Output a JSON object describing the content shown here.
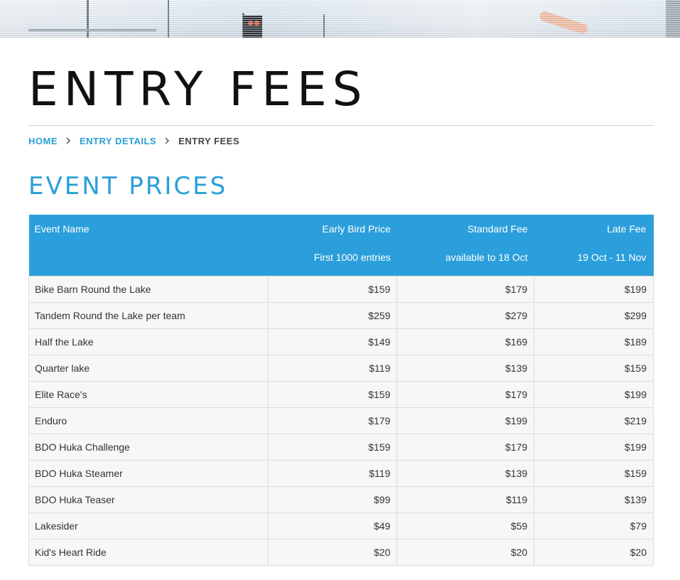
{
  "page": {
    "title": "ENTRY FEES",
    "section_title": "EVENT PRICES"
  },
  "breadcrumb": {
    "items": [
      {
        "label": "HOME"
      },
      {
        "label": "ENTRY DETAILS"
      },
      {
        "label": "ENTRY FEES"
      }
    ]
  },
  "colors": {
    "accent": "#2b9fdb",
    "title": "#111111",
    "row_bg": "#f7f7f7",
    "border": "#dcdcdc"
  },
  "table": {
    "headers": [
      {
        "line1": "Event Name",
        "line2": ""
      },
      {
        "line1": "Early Bird Price",
        "line2": "First 1000 entries"
      },
      {
        "line1": "Standard Fee",
        "line2": "available to 18 Oct"
      },
      {
        "line1": "Late Fee",
        "line2": "19 Oct - 11 Nov"
      }
    ],
    "rows": [
      [
        "Bike Barn Round the Lake",
        "$159",
        "$179",
        "$199"
      ],
      [
        "Tandem Round the Lake per team",
        "$259",
        "$279",
        "$299"
      ],
      [
        "Half the Lake",
        "$149",
        "$169",
        "$189"
      ],
      [
        "Quarter lake",
        "$119",
        "$139",
        "$159"
      ],
      [
        "Elite Race's",
        "$159",
        "$179",
        "$199"
      ],
      [
        "Enduro",
        "$179",
        "$199",
        "$219"
      ],
      [
        "BDO Huka Challenge",
        "$159",
        "$179",
        "$199"
      ],
      [
        "BDO Huka Steamer",
        "$119",
        "$139",
        "$159"
      ],
      [
        "BDO Huka Teaser",
        "$99",
        "$119",
        "$139"
      ],
      [
        "Lakesider",
        "$49",
        "$59",
        "$79"
      ],
      [
        "Kid's Heart Ride",
        "$20",
        "$20",
        "$20"
      ]
    ]
  }
}
